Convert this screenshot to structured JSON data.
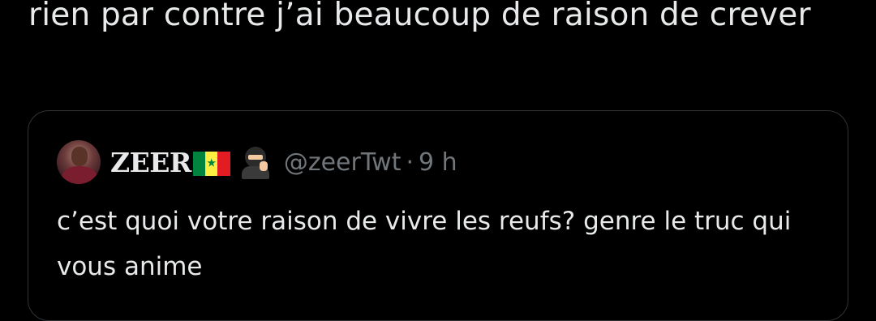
{
  "tweet": {
    "text": "rien par contre j’ai beaucoup de raison de crever"
  },
  "quoted_tweet": {
    "display_name": "ZEER",
    "flag_emoji": "senegal-flag",
    "emoji": "ninja",
    "handle": "@zeerTwt",
    "separator": "·",
    "time": "9 h",
    "text": "c’est quoi votre raison de vivre les reufs? genre le truc qui vous anime"
  },
  "colors": {
    "background": "#000000",
    "text": "#e7e9ea",
    "secondary": "#71767b",
    "border": "#2f3336"
  }
}
